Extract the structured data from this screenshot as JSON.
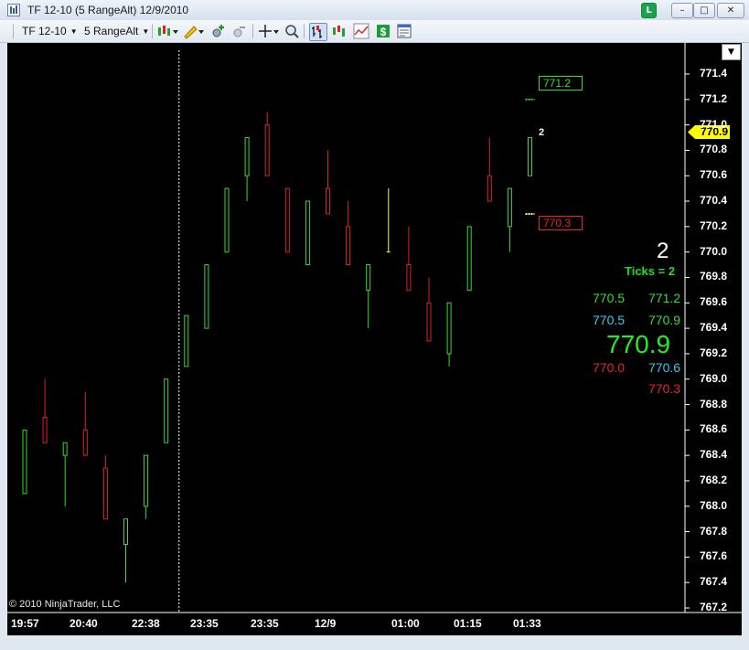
{
  "window": {
    "title": "TF 12-10 (5 RangeAlt)  12/9/2010",
    "link_label": "L",
    "minimize_label": "–",
    "restore_label": "□",
    "close_label": "✕"
  },
  "toolbar": {
    "instrument": "TF 12-10",
    "period": "5 RangeAlt",
    "icons": [
      "chart-style-icon",
      "draw-tool-icon",
      "zoom-in-icon",
      "zoom-out-icon",
      "crosshair-icon",
      "magnifier-icon",
      "bar-chart-icon",
      "candlestick-icon",
      "line-chart-icon",
      "dollar-icon",
      "properties-icon"
    ]
  },
  "chart": {
    "copyright": "© 2010 NinjaTrader, LLC",
    "current_price": "770.9",
    "target_tag": "771.2",
    "stop_tag": "770.3",
    "bar_counter": "2",
    "colors": {
      "up": "#33dd33",
      "down": "#dd2222",
      "doji": "#ffff66",
      "background": "#000000"
    }
  },
  "side_panel": {
    "big_count": "2",
    "ticks_label": "Ticks = 2",
    "row1_left": "770.5",
    "row1_right": "771.2",
    "row2_left": "770.5",
    "row2_right": "770.9",
    "big_price": "770.9",
    "row3_left": "770.0",
    "row3_right": "770.6",
    "row4_right": "770.3"
  },
  "chart_data": {
    "type": "candlestick",
    "y_axis_ticks": [
      "771.4",
      "771.2",
      "771.0",
      "770.8",
      "770.6",
      "770.4",
      "770.2",
      "770.0",
      "769.8",
      "769.6",
      "769.4",
      "769.2",
      "769.0",
      "768.8",
      "768.6",
      "768.4",
      "768.2",
      "768.0",
      "767.8",
      "767.6",
      "767.4",
      "767.2"
    ],
    "ylim": [
      767.2,
      771.5
    ],
    "x_axis_labels": [
      "19:57",
      "20:40",
      "22:38",
      "23:35",
      "23:35",
      "12/9",
      "01:00",
      "01:15",
      "01:33"
    ],
    "session_break_after_bar": 8,
    "bars": [
      {
        "o": 768.1,
        "h": 768.6,
        "l": 768.1,
        "c": 768.6
      },
      {
        "o": 768.7,
        "h": 769.0,
        "l": 768.5,
        "c": 768.5
      },
      {
        "o": 768.4,
        "h": 768.5,
        "l": 768.0,
        "c": 768.5
      },
      {
        "o": 768.6,
        "h": 768.9,
        "l": 768.4,
        "c": 768.4
      },
      {
        "o": 768.3,
        "h": 768.4,
        "l": 767.9,
        "c": 767.9
      },
      {
        "o": 767.7,
        "h": 767.9,
        "l": 767.4,
        "c": 767.9
      },
      {
        "o": 768.0,
        "h": 768.4,
        "l": 767.9,
        "c": 768.4
      },
      {
        "o": 768.5,
        "h": 769.0,
        "l": 768.5,
        "c": 769.0
      },
      {
        "o": 769.1,
        "h": 769.5,
        "l": 769.1,
        "c": 769.5
      },
      {
        "o": 769.4,
        "h": 769.9,
        "l": 769.4,
        "c": 769.9
      },
      {
        "o": 770.0,
        "h": 770.5,
        "l": 770.0,
        "c": 770.5
      },
      {
        "o": 770.6,
        "h": 770.9,
        "l": 770.4,
        "c": 770.9
      },
      {
        "o": 771.0,
        "h": 771.1,
        "l": 770.6,
        "c": 770.6
      },
      {
        "o": 770.5,
        "h": 770.5,
        "l": 770.0,
        "c": 770.0
      },
      {
        "o": 769.9,
        "h": 770.4,
        "l": 769.9,
        "c": 770.4
      },
      {
        "o": 770.5,
        "h": 770.8,
        "l": 770.3,
        "c": 770.3
      },
      {
        "o": 770.2,
        "h": 770.4,
        "l": 769.9,
        "c": 769.9
      },
      {
        "o": 769.7,
        "h": 769.9,
        "l": 769.4,
        "c": 769.9
      },
      {
        "o": 770.0,
        "h": 770.5,
        "l": 770.0,
        "c": 770.0
      },
      {
        "o": 769.9,
        "h": 770.2,
        "l": 769.7,
        "c": 769.7
      },
      {
        "o": 769.6,
        "h": 769.8,
        "l": 769.3,
        "c": 769.3
      },
      {
        "o": 769.2,
        "h": 769.6,
        "l": 769.1,
        "c": 769.6
      },
      {
        "o": 769.7,
        "h": 770.2,
        "l": 769.7,
        "c": 770.2
      },
      {
        "o": 770.6,
        "h": 770.9,
        "l": 770.4,
        "c": 770.4
      },
      {
        "o": 770.2,
        "h": 770.5,
        "l": 770.0,
        "c": 770.5
      },
      {
        "o": 770.6,
        "h": 770.9,
        "l": 770.6,
        "c": 770.9
      }
    ]
  }
}
